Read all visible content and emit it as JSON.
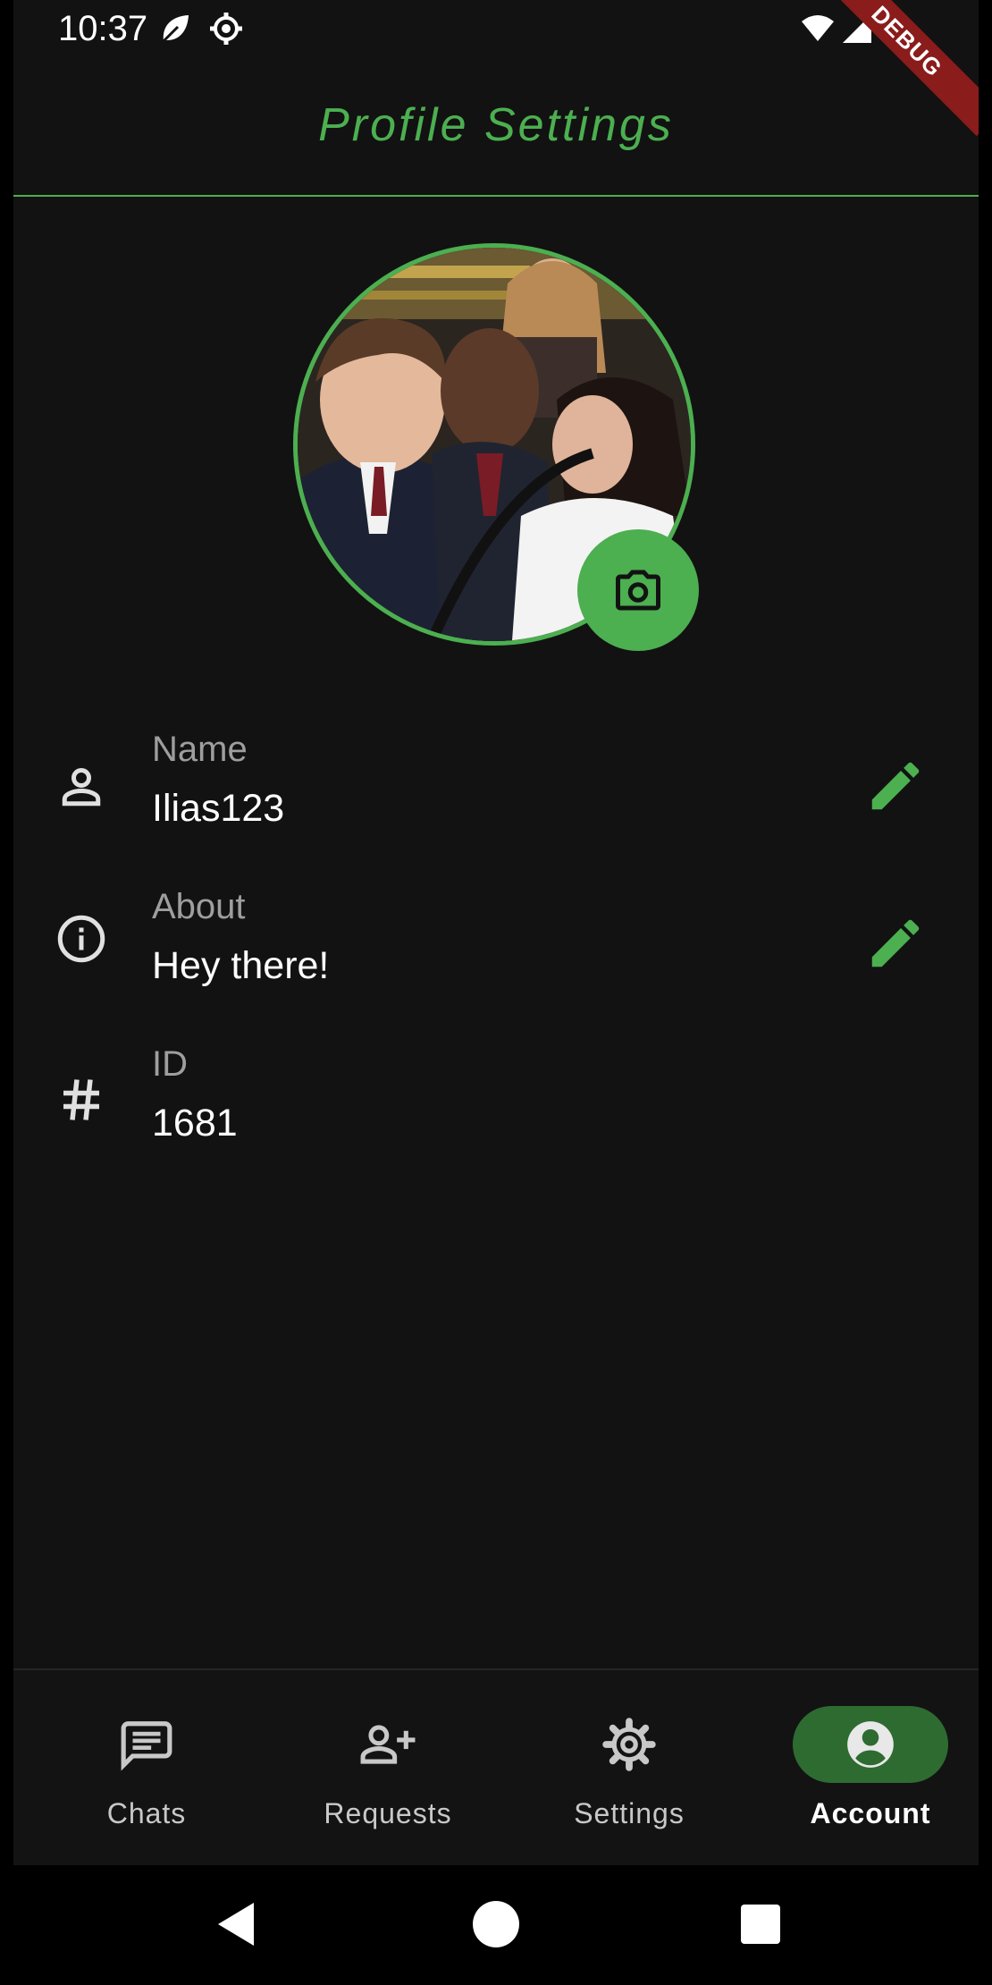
{
  "status_bar": {
    "time": "10:37",
    "debug_label": "DEBUG"
  },
  "app_bar": {
    "title": "Profile Settings"
  },
  "colors": {
    "accent": "#4caf50",
    "background": "#121212",
    "active_nav": "#2e6b31"
  },
  "profile": {
    "fields": [
      {
        "label": "Name",
        "value": "Ilias123",
        "icon": "person-icon",
        "editable": true
      },
      {
        "label": "About",
        "value": "Hey there!",
        "icon": "info-icon",
        "editable": true
      },
      {
        "label": "ID",
        "value": "1681",
        "icon": "hash-icon",
        "editable": false
      }
    ]
  },
  "bottom_nav": {
    "items": [
      {
        "label": "Chats",
        "icon": "chat-icon",
        "active": false
      },
      {
        "label": "Requests",
        "icon": "person-add-icon",
        "active": false
      },
      {
        "label": "Settings",
        "icon": "gear-icon",
        "active": false
      },
      {
        "label": "Account",
        "icon": "account-circle-icon",
        "active": true
      }
    ]
  }
}
